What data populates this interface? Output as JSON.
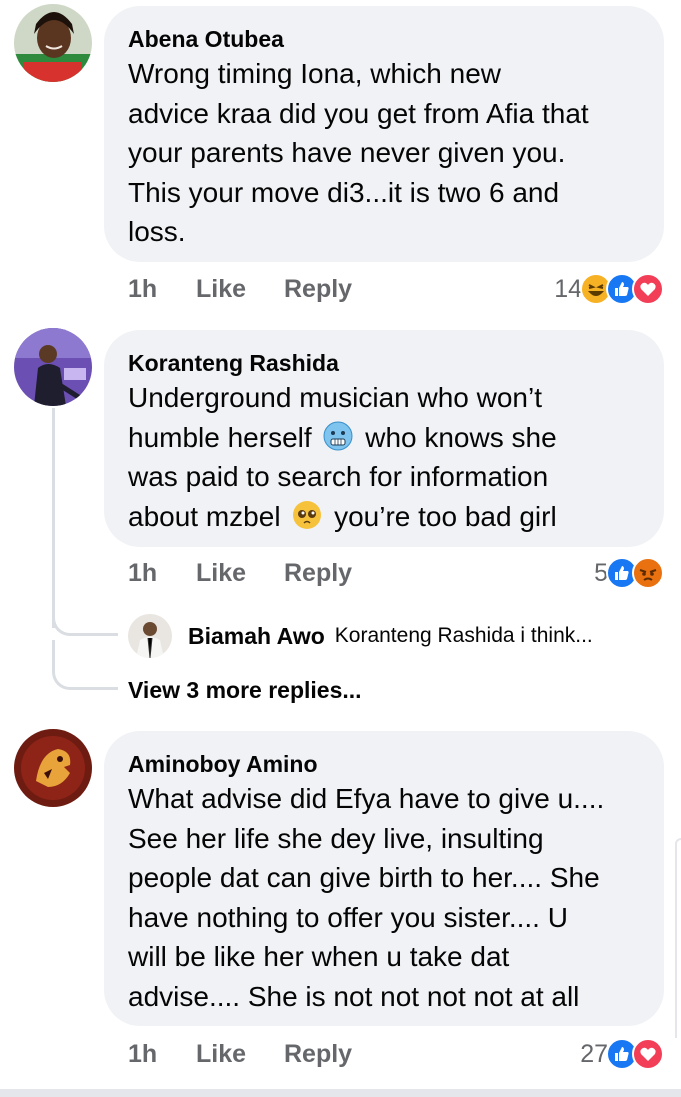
{
  "comments": [
    {
      "author": "Abena Otubea",
      "lines": [
        "Wrong timing Iona,  which new",
        "advice kraa did you get from Afia that",
        "your parents have never given you.",
        "This your move di3...it is two 6 and",
        "loss."
      ],
      "time": "1h",
      "like_label": "Like",
      "reply_label": "Reply",
      "reaction_count": "14",
      "reactions": [
        "haha-icon",
        "like-icon",
        "love-icon"
      ]
    },
    {
      "author": "Koranteng Rashida",
      "line1": "Underground musician who won’t",
      "line2_a": "humble herself",
      "line2_b": "who knows she",
      "line3": "was paid to search for information",
      "line4_a": "about mzbel",
      "line4_b": "you’re too bad girl",
      "time": "1h",
      "like_label": "Like",
      "reply_label": "Reply",
      "reaction_count": "5",
      "reactions": [
        "like-icon",
        "angry-icon"
      ],
      "reply_preview": {
        "author": "Biamah Awo",
        "snippet": "Koranteng Rashida i think..."
      },
      "view_more": "View 3 more replies..."
    },
    {
      "author": "Aminoboy Amino",
      "lines": [
        "What advise did Efya have to give u....",
        "See her life she dey live, insulting",
        "people dat can give birth to her.... She",
        "have nothing to offer you sister.... U",
        "will be like her when u take dat",
        "advise.... She is not not not not at all"
      ],
      "time": "1h",
      "like_label": "Like",
      "reply_label": "Reply",
      "reaction_count": "27",
      "reactions": [
        "like-icon",
        "love-icon"
      ]
    }
  ],
  "colors": {
    "bubble": "#f0f2f5",
    "secondary_text": "#65676b",
    "like_blue": "#1877f2",
    "love_red": "#f33e58",
    "haha_yellow": "#f7b125",
    "angry_orange": "#e9710f"
  }
}
